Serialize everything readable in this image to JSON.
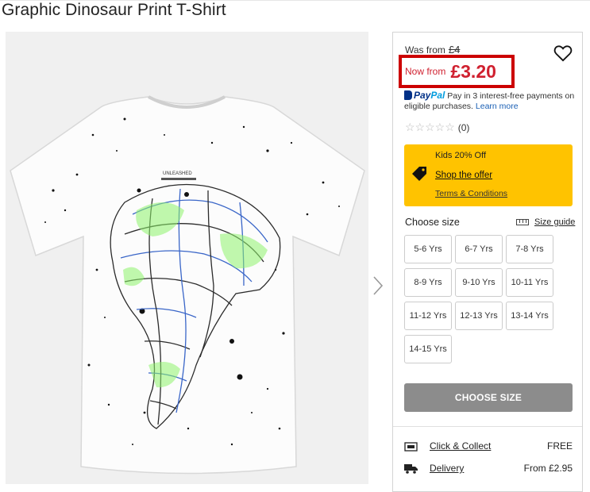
{
  "product": {
    "title": "Graphic Dinosaur Print T-Shirt",
    "image_label": "UNLEASHED"
  },
  "price": {
    "was_label": "Was from",
    "was_value": "£4",
    "now_label": "Now from",
    "now_value": "£3.20"
  },
  "paypal": {
    "logo_pay": "Pay",
    "logo_pal": "Pal",
    "text": "Pay in 3 interest-free payments on eligible purchases.",
    "learn_more": "Learn more"
  },
  "rating": {
    "stars": "☆☆☆☆☆",
    "count": "(0)"
  },
  "offer": {
    "title": "Kids 20% Off",
    "link": "Shop the offer",
    "terms": "Terms & Conditions",
    "bg_color": "#ffc300"
  },
  "sizes": {
    "label": "Choose size",
    "guide": "Size guide",
    "options": [
      "5-6 Yrs",
      "6-7 Yrs",
      "7-8 Yrs",
      "8-9 Yrs",
      "9-10 Yrs",
      "10-11 Yrs",
      "11-12 Yrs",
      "12-13 Yrs",
      "13-14 Yrs",
      "14-15 Yrs"
    ]
  },
  "cta": {
    "label": "CHOOSE SIZE"
  },
  "delivery": [
    {
      "icon": "click-collect-icon",
      "label": "Click & Collect",
      "price": "FREE"
    },
    {
      "icon": "delivery-truck-icon",
      "label": "Delivery",
      "price": "From £2.95"
    }
  ],
  "colors": {
    "sale_red": "#d0202f",
    "highlight_border": "#c00000",
    "button_grey": "#8c8c8c"
  }
}
